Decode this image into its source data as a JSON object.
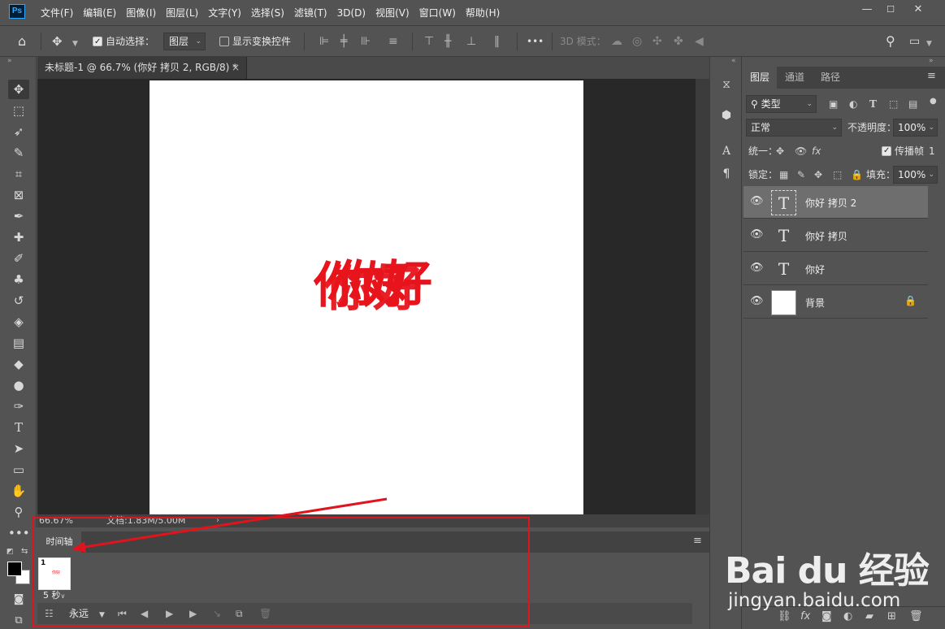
{
  "app": {
    "logo_text": "Ps"
  },
  "menu": [
    "文件(F)",
    "编辑(E)",
    "图像(I)",
    "图层(L)",
    "文字(Y)",
    "选择(S)",
    "滤镜(T)",
    "3D(D)",
    "视图(V)",
    "窗口(W)",
    "帮助(H)"
  ],
  "window_controls": {
    "minimize": "—",
    "maximize": "☐",
    "close": "✕"
  },
  "options_bar": {
    "auto_select_label": "自动选择：",
    "auto_select_checked": true,
    "auto_select_target": "图层",
    "show_transform_label": "显示变换控件",
    "show_transform_checked": false,
    "more": "•••",
    "mode_3d_label": "3D 模式："
  },
  "document": {
    "tab_title": "未标题-1 @ 66.7% (你好 拷贝 2, RGB/8) *",
    "close_glyph": "×",
    "canvas_text": "你好",
    "zoom": "66.67%",
    "doc_info": "文档:1.83M/5.00M"
  },
  "timeline": {
    "tab_label": "时间轴",
    "frame_number": "1",
    "frame_delay": "5 秒",
    "loop_option": "永远"
  },
  "layers_panel": {
    "tabs": [
      "图层",
      "通道",
      "路径"
    ],
    "active_tab": 0,
    "filter_label": "类型",
    "blend_mode": "正常",
    "opacity_label": "不透明度：",
    "opacity_value": "100%",
    "unify_label": "统一：",
    "propagate_label": "传播帧",
    "propagate_value": "1",
    "lock_label": "锁定：",
    "fill_label": "填充：",
    "fill_value": "100%",
    "layers": [
      {
        "name": "你好 拷贝 2",
        "type": "text",
        "selected": true,
        "locked": false
      },
      {
        "name": "你好 拷贝",
        "type": "text",
        "selected": false,
        "locked": false
      },
      {
        "name": "你好",
        "type": "text",
        "selected": false,
        "locked": false
      },
      {
        "name": "背景",
        "type": "raster",
        "selected": false,
        "locked": true
      }
    ]
  },
  "watermark": {
    "logo": "Bai du 经验",
    "url": "jingyan.baidu.com"
  },
  "colors": {
    "accent_red": "#e8141c",
    "panel_bg": "#535353",
    "canvas_bg": "#282828"
  }
}
